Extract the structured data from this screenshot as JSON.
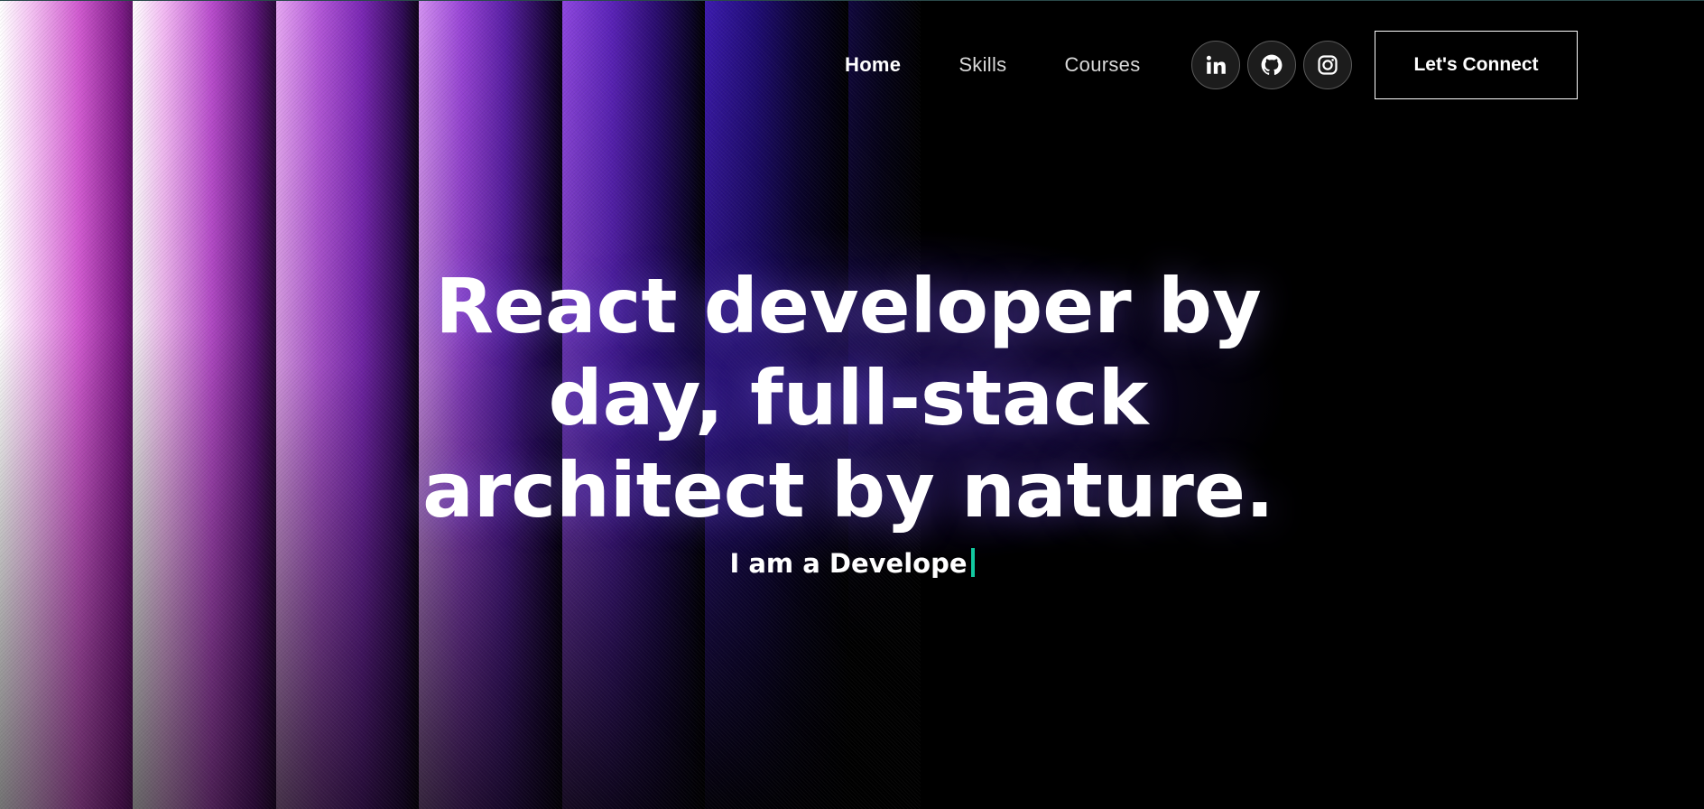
{
  "colors": {
    "background": "#000000",
    "accent_caret": "#12c9a0",
    "stripe_pink": "#d15ad0",
    "stripe_purple": "#5a22b8"
  },
  "nav": {
    "links": [
      {
        "label": "Home",
        "active": true
      },
      {
        "label": "Skills",
        "active": false
      },
      {
        "label": "Courses",
        "active": false
      }
    ],
    "social": [
      {
        "icon": "linkedin-icon"
      },
      {
        "icon": "github-icon"
      },
      {
        "icon": "instagram-icon"
      }
    ],
    "cta_label": "Let's Connect"
  },
  "hero": {
    "title_lines": [
      "React developer by",
      "day, full-stack",
      "architect by nature."
    ],
    "typing_text": "I am a Develope"
  }
}
